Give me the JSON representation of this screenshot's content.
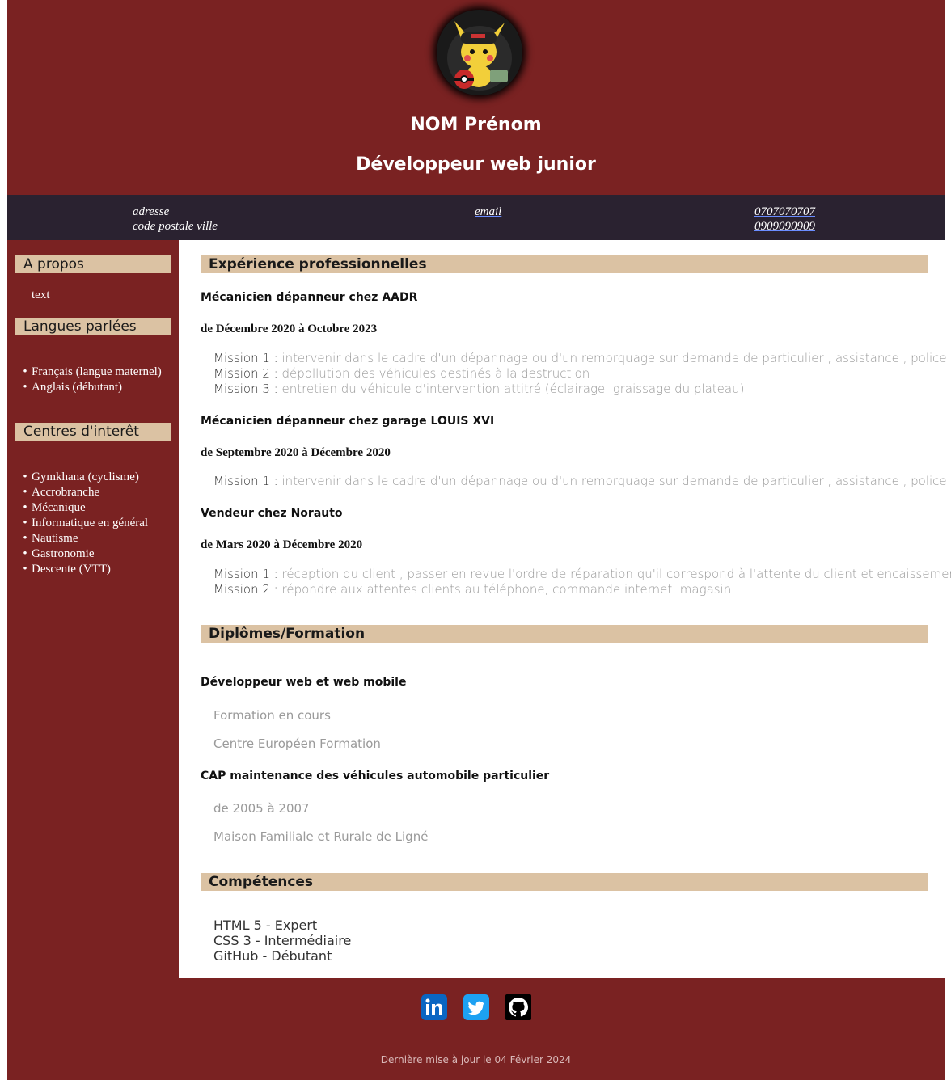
{
  "header": {
    "name": "NOM Prénom",
    "title": "Développeur web junior",
    "avatar_icon": "pikachu-avatar-icon"
  },
  "contact": {
    "address_line1": "adresse",
    "address_line2": "code postale ville",
    "email": "email",
    "phone1": "0707070707",
    "phone2": "0909090909"
  },
  "sidebar": {
    "about_heading": "A propos",
    "about_text": "text",
    "languages_heading": "Langues parlées",
    "languages": [
      "Français (langue maternel)",
      "Anglais (débutant)"
    ],
    "interests_heading": "Centres d'interêt",
    "interests": [
      "Gymkhana (cyclisme)",
      "Accrobranche",
      "Mécanique",
      "Informatique en général",
      "Nautisme",
      "Gastronomie",
      "Descente (VTT)"
    ]
  },
  "experience": {
    "heading": "Expérience professionnelles",
    "jobs": [
      {
        "title": "Mécanicien dépanneur chez AADR",
        "dates": "de Décembre 2020 à Octobre 2023",
        "missions": [
          {
            "label": "Mission 1 :",
            "text": " intervenir dans le cadre d'un dépannage ou d'un remorquage sur demande de particulier , assistance , police"
          },
          {
            "label": "Mission 2 :",
            "text": " dépollution des véhicules destinés à la destruction"
          },
          {
            "label": "Mission 3 :",
            "text": " entretien du véhicule d'intervention attitré (éclairage, graissage du plateau)"
          }
        ]
      },
      {
        "title": "Mécanicien dépanneur chez garage LOUIS XVI",
        "dates": "de Septembre 2020 à Décembre 2020",
        "missions": [
          {
            "label": "Mission 1 :",
            "text": " intervenir dans le cadre d'un dépannage ou d'un remorquage sur demande de particulier , assistance , police"
          }
        ]
      },
      {
        "title": "Vendeur chez Norauto",
        "dates": "de Mars 2020 à Décembre 2020",
        "missions": [
          {
            "label": "Mission 1 :",
            "text": " réception du client , passer en revue l'ordre de réparation qu'il correspond à l'attente du client et encaissement"
          },
          {
            "label": "Mission 2 :",
            "text": " répondre aux attentes clients au téléphone, commande internet, magasin"
          }
        ]
      }
    ]
  },
  "education": {
    "heading": "Diplômes/Formation",
    "items": [
      {
        "title": "Développeur web et web mobile",
        "line1": "Formation en cours",
        "line2": "Centre Européen Formation"
      },
      {
        "title": "CAP maintenance des véhicules automobile particulier",
        "line1": "de 2005 à 2007",
        "line2": "Maison Familiale et Rurale de Ligné"
      }
    ]
  },
  "skills": {
    "heading": "Compétences",
    "items": [
      "HTML 5 - Expert",
      "CSS 3 - Intermédiaire",
      "GitHub - Débutant"
    ]
  },
  "footer": {
    "social": [
      "linkedin-icon",
      "twitter-icon",
      "github-icon"
    ],
    "updated": "Dernière mise à jour le 04 Février 2024"
  },
  "colors": {
    "background": "#7a2222",
    "contact_bar": "#2a2230",
    "heading_band": "#dbc2a3"
  }
}
